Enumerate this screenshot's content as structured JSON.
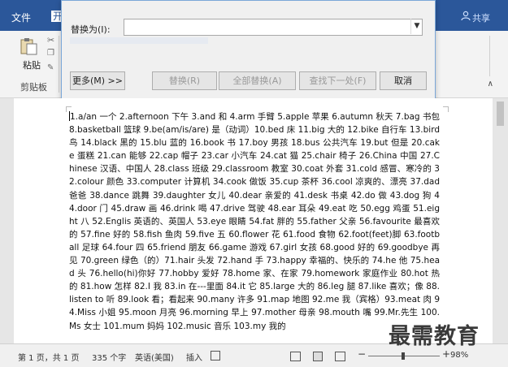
{
  "ribbon": {
    "tab_file": "文件",
    "tab_start": "开",
    "share": "共享",
    "paste_label": "粘贴",
    "clipboard_label": "剪贴板"
  },
  "dialog": {
    "replace_label": "替换为(I):",
    "replace_value": "",
    "buttons": {
      "more": "更多(M) >>",
      "replace": "替换(R)",
      "replace_all": "全部替换(A)",
      "find_next": "查找下一处(F)",
      "cancel": "取消"
    }
  },
  "document": {
    "text": "1.a/an 一个 2.afternoon 下午 3.and 和 4.arm 手臂 5.apple 苹果 6.autumn 秋天 7.bag 书包 8.basketball 篮球 9.be(am/is/are) 是（动词）10.bed 床 11.big 大的 12.bike 自行车 13.bird 鸟 14.black 黑的 15.blu 蓝的 16.book 书 17.boy 男孩 18.bus 公共汽车 19.but 但是 20.cake 蛋糕 21.can 能够 22.cap 帽子 23.car 小汽车 24.cat 猫 25.chair 椅子 26.China 中国 27.Chinese 汉语、中国人 28.class 班级 29.classroom 教室 30.coat 外套 31.cold 感冒、寒冷的 32.colour 颜色 33.computer 计算机 34.cook 做饭 35.cup 茶杯 36.cool 凉爽的、漂亮 37.dad 爸爸 38.dance 跳舞 39.daughter 女儿 40.dear 亲爱的 41.desk 书桌 42.do 做 43.dog 狗 44.door 门 45.draw 画 46.drink 喝 47.drive 驾驶 48.ear 耳朵 49.eat 吃 50.egg 鸡蛋 51.eight 八 52.Englis 英语的、英国人 53.eye 眼睛 54.fat 胖的 55.father 父亲 56.favourite 最喜欢的 57.fine 好的 58.fish 鱼肉 59.five 五 60.flower 花 61.food 食物 62.foot(feet)脚 63.football 足球 64.four 四 65.friend 朋友 66.game 游戏 67.girl 女孩 68.good 好的 69.goodbye 再见 70.green 绿色（的）71.hair 头发 72.hand 手 73.happy 幸福的、快乐的 74.he 他 75.head 头 76.hello(hi)你好 77.hobby 爱好 78.home 家、在家 79.homework 家庭作业 80.hot 热的 81.how 怎样 82.I 我 83.in 在---里面 84.it 它 85.large 大的 86.leg 腿 87.like 喜欢；像 88.listen to 听 89.look 看；看起来 90.many 许多 91.map 地图 92.me 我（宾格）93.meat 肉 94.Miss 小姐 95.moon 月亮 96.morning 早上 97.mother 母亲 98.mouth 嘴 99.Mr.先生 100.Ms 女士 101.mum 妈妈 102.music 音乐 103.my 我的"
  },
  "statusbar": {
    "page": "第 1 页，共 1 页",
    "words": "335 个字",
    "language": "英语(美国)",
    "mode": "插入",
    "zoom": "98%",
    "zoom_level": 0.98
  },
  "watermark": "最需教育"
}
